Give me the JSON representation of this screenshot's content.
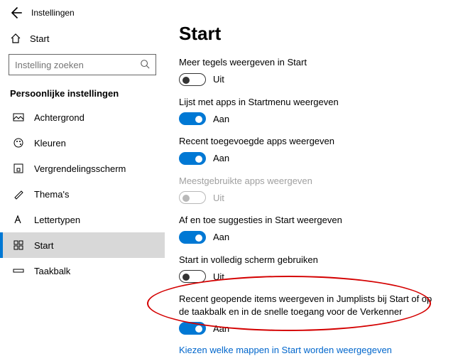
{
  "header": {
    "app_title": "Instellingen"
  },
  "sidebar": {
    "home_label": "Start",
    "search_placeholder": "Instelling zoeken",
    "category_label": "Persoonlijke instellingen",
    "items": [
      {
        "label": "Achtergrond"
      },
      {
        "label": "Kleuren"
      },
      {
        "label": "Vergrendelingsscherm"
      },
      {
        "label": "Thema's"
      },
      {
        "label": "Lettertypen"
      },
      {
        "label": "Start"
      },
      {
        "label": "Taakbalk"
      }
    ]
  },
  "page": {
    "title": "Start",
    "settings": [
      {
        "label": "Meer tegels weergeven in Start",
        "on": false,
        "state_text": "Uit",
        "disabled": false
      },
      {
        "label": "Lijst met apps in Startmenu weergeven",
        "on": true,
        "state_text": "Aan",
        "disabled": false
      },
      {
        "label": "Recent toegevoegde apps weergeven",
        "on": true,
        "state_text": "Aan",
        "disabled": false
      },
      {
        "label": "Meestgebruikte apps weergeven",
        "on": false,
        "state_text": "Uit",
        "disabled": true
      },
      {
        "label": "Af en toe suggesties in Start weergeven",
        "on": true,
        "state_text": "Aan",
        "disabled": false
      },
      {
        "label": "Start in volledig scherm gebruiken",
        "on": false,
        "state_text": "Uit",
        "disabled": false
      },
      {
        "label": "Recent geopende items weergeven in Jumplists bij Start of op de taakbalk en in de snelle toegang voor de Verkenner",
        "on": true,
        "state_text": "Aan",
        "disabled": false
      }
    ],
    "link_text": "Kiezen welke mappen in Start worden weergegeven"
  }
}
